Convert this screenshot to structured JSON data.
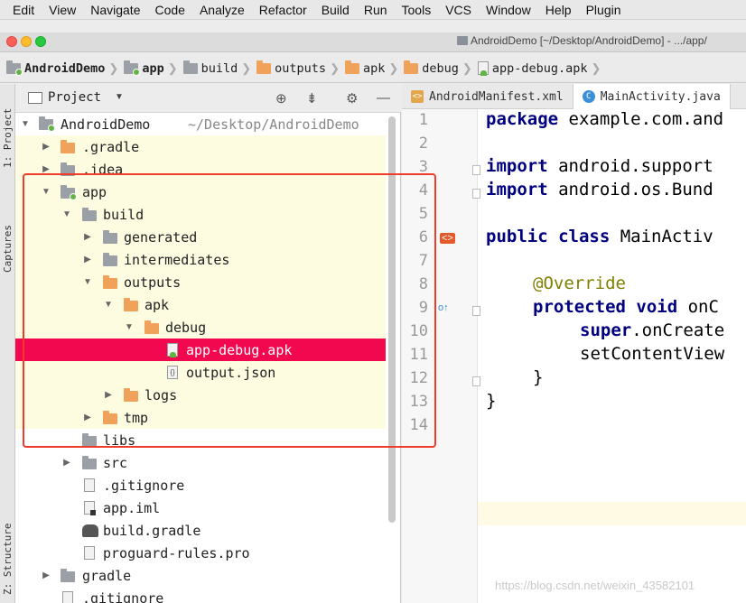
{
  "menubar": {
    "items": [
      "Edit",
      "View",
      "Navigate",
      "Code",
      "Analyze",
      "Refactor",
      "Build",
      "Run",
      "Tools",
      "VCS",
      "Window",
      "Help",
      "Plugin"
    ]
  },
  "window": {
    "title": "AndroidDemo [~/Desktop/AndroidDemo] - .../app/"
  },
  "breadcrumb": {
    "items": [
      "AndroidDemo",
      "app",
      "build",
      "outputs",
      "apk",
      "debug",
      "app-debug.apk"
    ]
  },
  "toolstrip": {
    "project_tab": "1: Project",
    "captures_tab": "Captures",
    "structure_tab": "Z: Structure"
  },
  "project_panel": {
    "title": "Project",
    "root_hint": "~/Desktop/AndroidDemo",
    "tree": [
      {
        "label": "AndroidDemo",
        "arrow": "▼",
        "icon": "module-folder"
      },
      {
        "label": ".gradle",
        "arrow": "▶",
        "icon": "folder-orange"
      },
      {
        "label": ".idea",
        "arrow": "▶",
        "icon": "folder-gray"
      },
      {
        "label": "app",
        "arrow": "▼",
        "icon": "module-folder"
      },
      {
        "label": "build",
        "arrow": "▼",
        "icon": "folder-gray"
      },
      {
        "label": "generated",
        "arrow": "▶",
        "icon": "folder-gray"
      },
      {
        "label": "intermediates",
        "arrow": "▶",
        "icon": "folder-gray"
      },
      {
        "label": "outputs",
        "arrow": "▼",
        "icon": "folder-orange"
      },
      {
        "label": "apk",
        "arrow": "▼",
        "icon": "folder-orange"
      },
      {
        "label": "debug",
        "arrow": "▼",
        "icon": "folder-orange"
      },
      {
        "label": "app-debug.apk",
        "arrow": "",
        "icon": "apk-file"
      },
      {
        "label": "output.json",
        "arrow": "",
        "icon": "json-file"
      },
      {
        "label": "logs",
        "arrow": "▶",
        "icon": "folder-orange"
      },
      {
        "label": "tmp",
        "arrow": "▶",
        "icon": "folder-orange"
      },
      {
        "label": "libs",
        "arrow": "",
        "icon": "folder-gray"
      },
      {
        "label": "src",
        "arrow": "▶",
        "icon": "folder-gray"
      },
      {
        "label": ".gitignore",
        "arrow": "",
        "icon": "text-file"
      },
      {
        "label": "app.iml",
        "arrow": "",
        "icon": "iml-file"
      },
      {
        "label": "build.gradle",
        "arrow": "",
        "icon": "gradle-icon"
      },
      {
        "label": "proguard-rules.pro",
        "arrow": "",
        "icon": "text-file"
      },
      {
        "label": "gradle",
        "arrow": "▶",
        "icon": "folder-gray"
      },
      {
        "label": ".gitignore",
        "arrow": "",
        "icon": "text-file"
      }
    ],
    "selected": "app-debug.apk"
  },
  "editor": {
    "tabs": [
      "AndroidManifest.xml",
      "MainActivity.java"
    ],
    "active_tab": "MainActivity.java",
    "line_numbers": [
      "1",
      "2",
      "3",
      "4",
      "5",
      "6",
      "7",
      "8",
      "9",
      "10",
      "11",
      "12",
      "13",
      "14"
    ],
    "code": {
      "l1_kw": "package",
      "l1_rest": " example.com.and",
      "l3_kw": "import",
      "l3_rest": " android.support",
      "l4_kw": "import",
      "l4_rest": " android.os.Bund",
      "l6_kw": "public class",
      "l6_rest": " MainActiv",
      "l8_ann": "@Override",
      "l9_kw": "protected void",
      "l9_rest": " onC",
      "l10_kw": "super",
      "l10_rest": ".onCreate",
      "l11_rest": "setContentView",
      "l12_rest": "}",
      "l13_rest": "}"
    }
  },
  "watermark": "https://blog.csdn.net/weixin_43582101",
  "colors": {
    "selection": "#f2084f",
    "highlight": "#fdfbe0",
    "annotation_box": "#f03a2a",
    "keyword": "#000080"
  }
}
